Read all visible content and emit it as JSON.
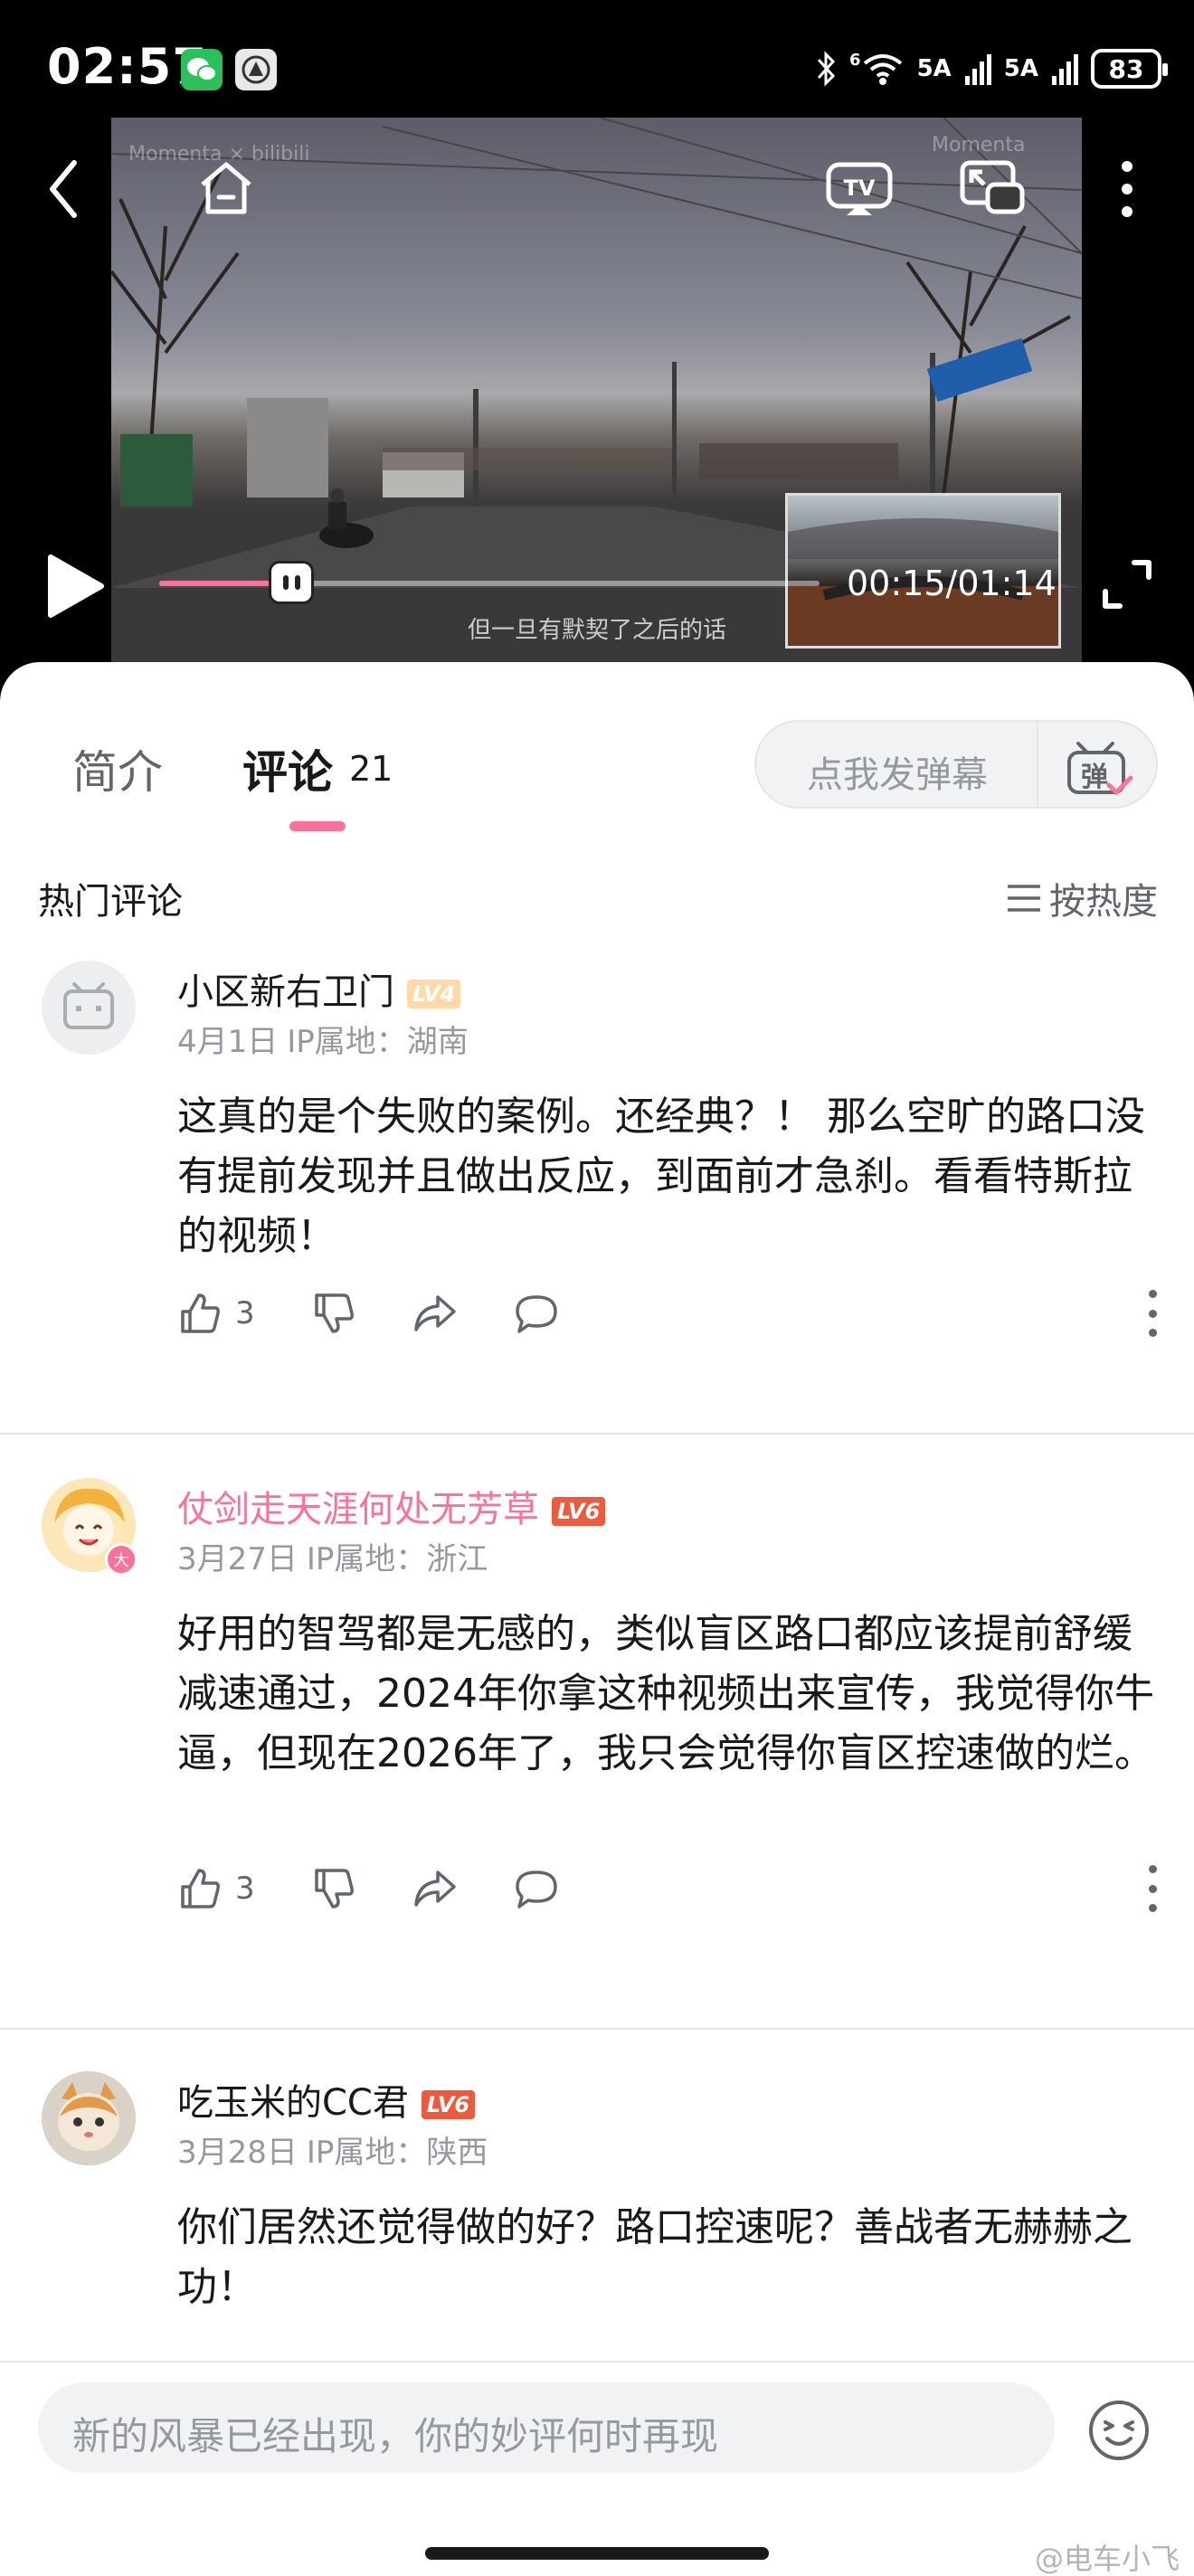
{
  "status_bar": {
    "time": "02:57",
    "signal1": "5A",
    "signal2": "5A",
    "wifi_label": "6",
    "battery": "83"
  },
  "video": {
    "watermark_left": "Momenta × bilibili",
    "watermark_right": "Momenta",
    "time_current": "00:15",
    "time_total": "01:14",
    "time_display": "00:15/01:14",
    "progress": 0.2,
    "subtitle": "但一旦有默契了之后的话"
  },
  "tabs": {
    "intro": "简介",
    "comments": "评论",
    "comment_count": "21"
  },
  "danmaku": {
    "placeholder": "点我发弹幕",
    "icon_label": "弹"
  },
  "comments_header": {
    "title": "热门评论",
    "sort": "按热度"
  },
  "comments": [
    {
      "username": "小区新右卫门",
      "level": "LV4",
      "date": "4月1日",
      "ip": "IP属地：湖南",
      "text": "这真的是个失败的案例。还经典？！ 那么空旷的路口没有提前发现并且做出反应，到面前才急刹。看看特斯拉的视频！",
      "likes": "3"
    },
    {
      "username": "仗剑走天涯何处无芳草",
      "level": "LV6",
      "badge": "大",
      "date": "3月27日",
      "ip": "IP属地：浙江",
      "text": "好用的智驾都是无感的，类似盲区路口都应该提前舒缓减速通过，2024年你拿这种视频出来宣传，我觉得你牛逼，但现在2026年了，我只会觉得你盲区控速做的烂。",
      "likes": "3"
    },
    {
      "username": "吃玉米的CC君",
      "level": "LV6",
      "date": "3月28日",
      "ip": "IP属地：陕西",
      "text": "你们居然还觉得做的好？路口控速呢？善战者无赫赫之功！"
    }
  ],
  "composer": {
    "placeholder": "新的风暴已经出现，你的妙评何时再现"
  },
  "watermark": "@电车小飞",
  "colors": {
    "accent_pink": "#fb7299",
    "text_primary": "#18191c",
    "text_secondary": "#9499a0",
    "lv4": "#ffd9a8",
    "lv6": "#ee5a3c"
  }
}
